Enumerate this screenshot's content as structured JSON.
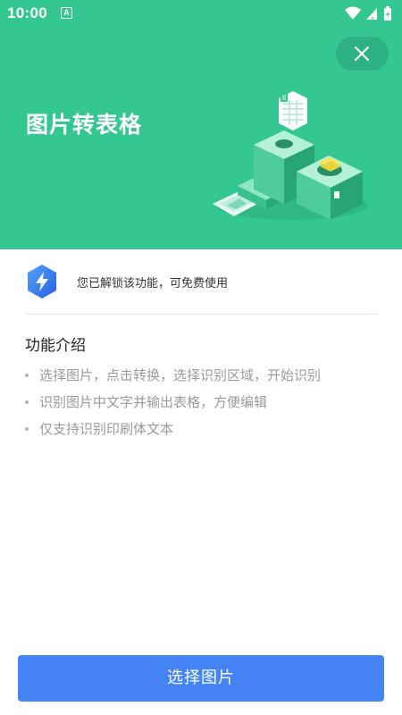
{
  "status_bar": {
    "time": "10:00",
    "notification_icon": "A",
    "icons": [
      "wifi-icon",
      "signal-icon",
      "battery-charging-icon"
    ]
  },
  "header": {
    "title": "图片转表格",
    "background_color": "#34c792",
    "close_icon": "close-icon"
  },
  "unlock": {
    "icon": "lightning-badge-icon",
    "text": "您已解锁该功能，可免费使用"
  },
  "intro": {
    "title": "功能介绍",
    "items": [
      "选择图片，点击转换，选择识别区域，开始识别",
      "识别图片中文字并输出表格，方便编辑",
      "仅支持识别印刷体文本"
    ]
  },
  "action": {
    "button_label": "选择图片",
    "color": "#4484f4"
  }
}
